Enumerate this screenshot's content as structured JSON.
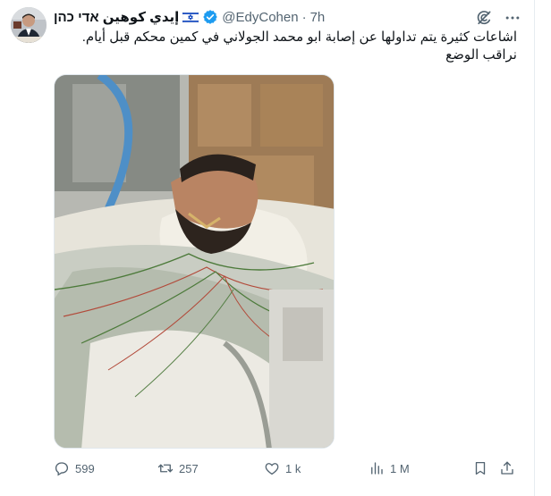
{
  "post": {
    "display_name": "إيدي كوهين אדי כהן",
    "handle": "@EdyCohen",
    "separator": "·",
    "time": "7h",
    "text": "اشاعات كثيرة يتم تداولها عن إصابة ابو محمد الجولاني في كمين محكم قبل أيام. نراقب الوضع"
  },
  "icons": {
    "flag": "israel-flag-icon",
    "verified": "verified-badge-icon",
    "grok": "grok-icon",
    "more": "more-icon",
    "reply": "reply-icon",
    "retweet": "retweet-icon",
    "like": "like-icon",
    "views": "views-icon",
    "bookmark": "bookmark-icon",
    "share": "share-icon"
  },
  "metrics": {
    "replies": "599",
    "retweets": "257",
    "likes": "1 k",
    "views": "1 M"
  },
  "colors": {
    "text": "#0f1419",
    "secondary": "#536471",
    "verified": "#1d9bf0",
    "flag_blue": "#0038b8"
  }
}
